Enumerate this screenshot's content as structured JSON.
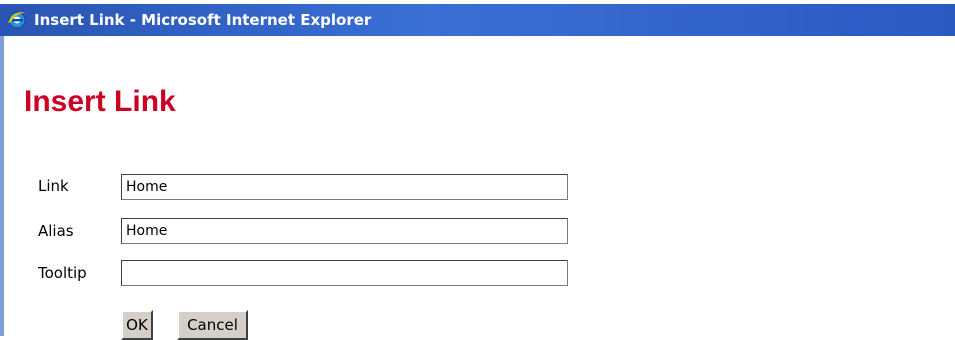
{
  "window": {
    "title": "Insert Link - Microsoft Internet Explorer",
    "icon": "ie-icon"
  },
  "page": {
    "heading": "Insert Link"
  },
  "form": {
    "link_label": "Link",
    "link_value": "Home",
    "alias_label": "Alias",
    "alias_value": "Home",
    "tooltip_label": "Tooltip",
    "tooltip_value": ""
  },
  "buttons": {
    "ok": "OK",
    "cancel": "Cancel"
  },
  "colors": {
    "title_bar": "#2a55b3",
    "heading": "#cc0022",
    "button_face": "#d4d0c8"
  }
}
